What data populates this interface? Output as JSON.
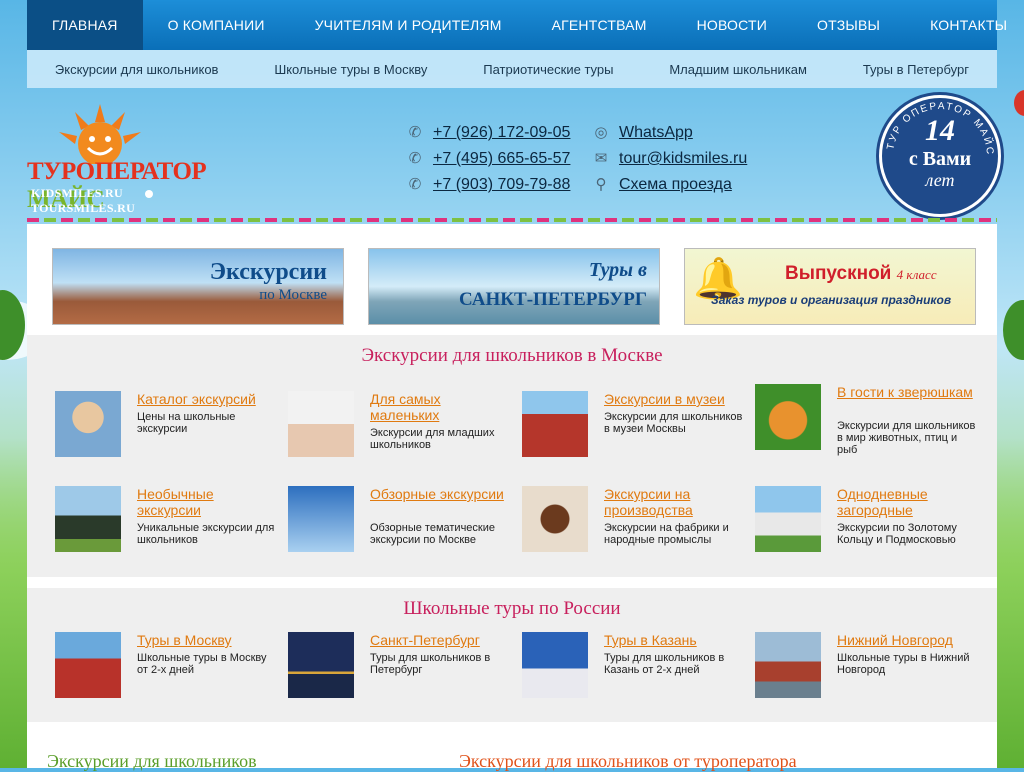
{
  "topnav": [
    {
      "label": "Главная",
      "active": true
    },
    {
      "label": "О компании"
    },
    {
      "label": "Учителям и родителям"
    },
    {
      "label": "Агентствам"
    },
    {
      "label": "Новости"
    },
    {
      "label": "Отзывы"
    },
    {
      "label": "Контакты"
    }
  ],
  "subnav": [
    "Экскурсии для школьников",
    "Школьные туры в Москву",
    "Патриотические туры",
    "Младшим школьникам",
    "Туры в Петербург"
  ],
  "logo": {
    "brand_red": "ТУРОПЕРАТОР",
    "brand_green": "МАЙС",
    "site1": "KIDSMILES.RU",
    "site2": "TOURSMILES.RU"
  },
  "phones": [
    "+7 (926) 172-09-05",
    "+7 (495) 665-65-57",
    "+7 (903) 709-79-88"
  ],
  "links": {
    "whatsapp": "WhatsApp",
    "email": "tour@kidsmiles.ru",
    "map": "Схема проезда"
  },
  "badge": {
    "ring": "ТУР ОПЕРАТОР МАЙС",
    "num": "14",
    "mid": "с Вами",
    "bot": "лет"
  },
  "banners": [
    {
      "line1": "Экскурсии",
      "line2": "по Москве"
    },
    {
      "line1": "Туры в",
      "line2": "САНКТ-ПЕТЕРБУРГ"
    },
    {
      "line1": "Выпускной",
      "line1b": "4 класс",
      "line2": "Заказ туров и организация праздников"
    }
  ],
  "section1": {
    "title": "Экскурсии для школьников в Москве",
    "cards": [
      {
        "title": "Каталог экскурсий",
        "desc": "Цены на школьные экскурсии"
      },
      {
        "title": "Для самых маленьких",
        "desc": "Экскурсии для младших школьников"
      },
      {
        "title": "Экскурсии в музеи",
        "desc": "Экскурсии для школьников в музеи Москвы"
      },
      {
        "title": "В гости к зверюшкам",
        "desc": "Экскурсии для школьников в мир животных, птиц и рыб"
      },
      {
        "title": "Необычные экскурсии",
        "desc": "Уникальные экскурсии для школьников"
      },
      {
        "title": "Обзорные экскурсии",
        "desc": "Обзорные тематические экскурсии по Москве"
      },
      {
        "title": "Экскурсии на производства",
        "desc": "Экскурсии на фабрики и народные промыслы"
      },
      {
        "title": "Однодневные загородные",
        "desc": "Экскурсии по Золотому Кольцу и Подмосковью"
      }
    ]
  },
  "section2": {
    "title": "Школьные туры по России",
    "cards": [
      {
        "title": "Туры в Москву",
        "desc": "Школьные туры в Москву от 2-х дней"
      },
      {
        "title": "Санкт-Петербург",
        "desc": "Туры для школьников в Петербург"
      },
      {
        "title": "Туры в Казань",
        "desc": "Туры для школьников в Казань от 2-х дней"
      },
      {
        "title": "Нижний Новгород",
        "desc": "Школьные туры в Нижний Новгород"
      }
    ]
  },
  "bottom": {
    "left": "Экскурсии для школьников",
    "right": "Экскурсии для школьников от туроператора"
  },
  "colors": {
    "nav": "#1d8ed8",
    "nav_active": "#0b4f86",
    "link": "#e07a10",
    "section_title": "#c8205d",
    "bottom_left": "#5a9e2a",
    "bottom_right": "#e0521a"
  }
}
